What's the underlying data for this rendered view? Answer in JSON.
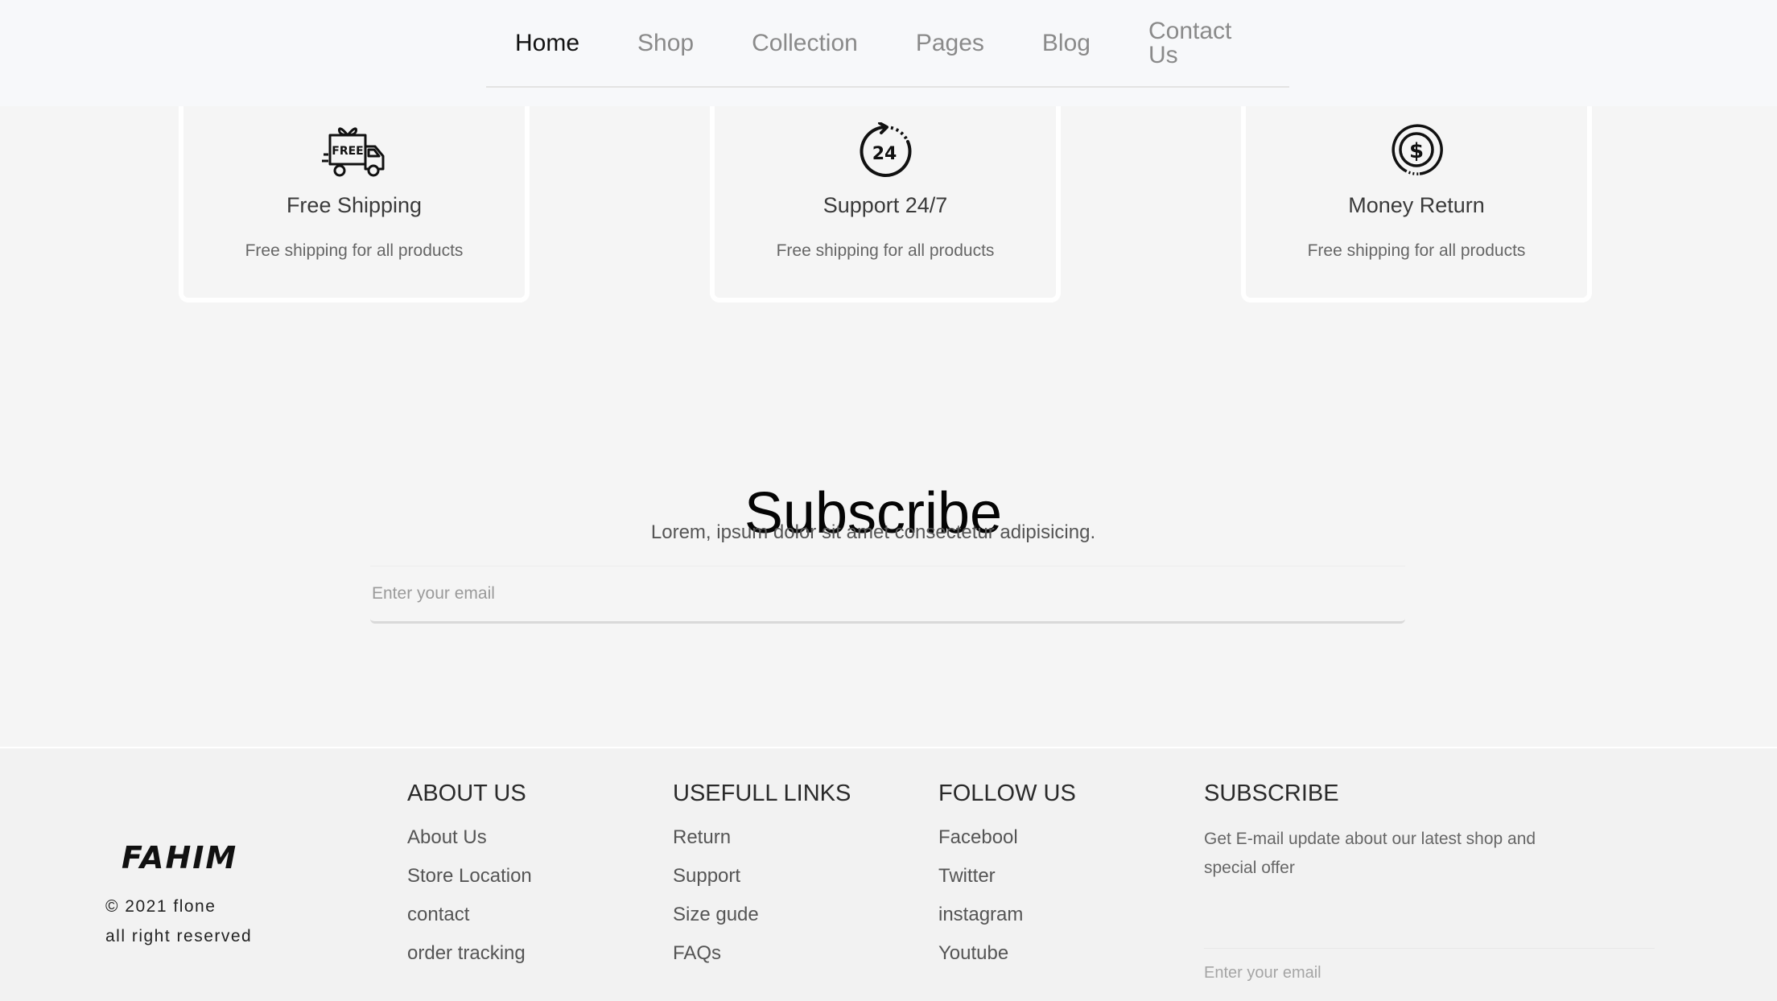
{
  "nav": {
    "items": [
      {
        "label": "Home",
        "active": true
      },
      {
        "label": "Shop",
        "active": false
      },
      {
        "label": "Collection",
        "active": false
      },
      {
        "label": "Pages",
        "active": false
      },
      {
        "label": "Blog",
        "active": false
      },
      {
        "label": "Contact Us",
        "active": false
      }
    ]
  },
  "features": [
    {
      "icon": "free-shipping-truck-icon",
      "title": "Free Shipping",
      "desc": "Free shipping for all products",
      "icon_text": "FREE"
    },
    {
      "icon": "support-24-7-icon",
      "title": "Support 24/7",
      "desc": "Free shipping for all products",
      "icon_text": "24"
    },
    {
      "icon": "money-return-icon",
      "title": "Money Return",
      "desc": "Free shipping for all products",
      "icon_text": "$"
    }
  ],
  "subscribe": {
    "title": "Subscribe",
    "text": "Lorem, ipsum dolor sit amet consectetur adipisicing.",
    "placeholder": "Enter your email"
  },
  "footer": {
    "logo": "FAHIM",
    "copyright_line1": "© 2021 flone",
    "copyright_line2": "all right reserved",
    "about": {
      "title": "ABOUT US",
      "links": [
        "About Us",
        "Store Location",
        "contact",
        "order tracking"
      ]
    },
    "useful": {
      "title": "USEFULL LINKS",
      "links": [
        "Return",
        "Support",
        "Size gude",
        "FAQs"
      ]
    },
    "follow": {
      "title": "FOLLOW US",
      "links": [
        "Facebool",
        "Twitter",
        "instagram",
        "Youtube"
      ]
    },
    "subscribe": {
      "title": "SUBSCRIBE",
      "text": "Get E-mail update about our latest shop and special offer",
      "placeholder": "Enter your email"
    }
  }
}
